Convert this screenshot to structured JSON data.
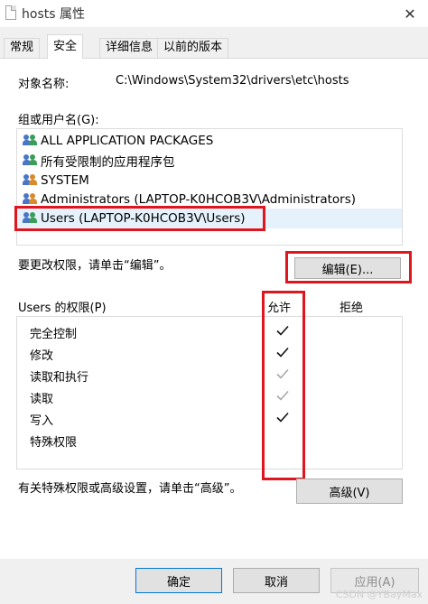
{
  "window": {
    "title": "hosts 属性",
    "close_glyph": "✕"
  },
  "tabs": [
    {
      "label": "常规",
      "active": false
    },
    {
      "label": "安全",
      "active": true
    },
    {
      "label": "详细信息",
      "active": false
    },
    {
      "label": "以前的版本",
      "active": false
    }
  ],
  "object": {
    "label": "对象名称:",
    "value": "C:\\Windows\\System32\\drivers\\etc\\hosts"
  },
  "groups": {
    "label": "组或用户名(G):",
    "items": [
      {
        "name": "ALL APPLICATION PACKAGES",
        "icon": "group-icon"
      },
      {
        "name": "所有受限制的应用程序包",
        "icon": "group-icon"
      },
      {
        "name": "SYSTEM",
        "icon": "group-icon"
      },
      {
        "name": "Administrators (LAPTOP-K0HCOB3V\\Administrators)",
        "icon": "group-icon"
      },
      {
        "name": "Users (LAPTOP-K0HCOB3V\\Users)",
        "icon": "group-icon",
        "selected": true
      }
    ]
  },
  "change_hint": "要更改权限，请单击“编辑”。",
  "edit_button": "编辑(E)...",
  "permissions": {
    "header": "Users 的权限(P)",
    "allow_label": "允许",
    "deny_label": "拒绝",
    "rows": [
      {
        "name": "完全控制",
        "allow": "✓",
        "allow_state": "checked"
      },
      {
        "name": "修改",
        "allow": "✓",
        "allow_state": "checked"
      },
      {
        "name": "读取和执行",
        "allow": "✓",
        "allow_state": "inherited"
      },
      {
        "name": "读取",
        "allow": "✓",
        "allow_state": "inherited"
      },
      {
        "name": "写入",
        "allow": "✓",
        "allow_state": "checked"
      },
      {
        "name": "特殊权限",
        "allow": "",
        "allow_state": "none"
      }
    ]
  },
  "advanced_hint": "有关特殊权限或高级设置，请单击“高级”。",
  "advanced_button": "高级(V)",
  "footer": {
    "ok": "确定",
    "cancel": "取消",
    "apply": "应用(A)"
  },
  "watermark": "CSDN @YBayMax",
  "colors": {
    "highlight_box": "#e0161f",
    "selection": "#e5f1fb",
    "check_active": "#111111",
    "check_inherited": "#a8a8a8"
  }
}
